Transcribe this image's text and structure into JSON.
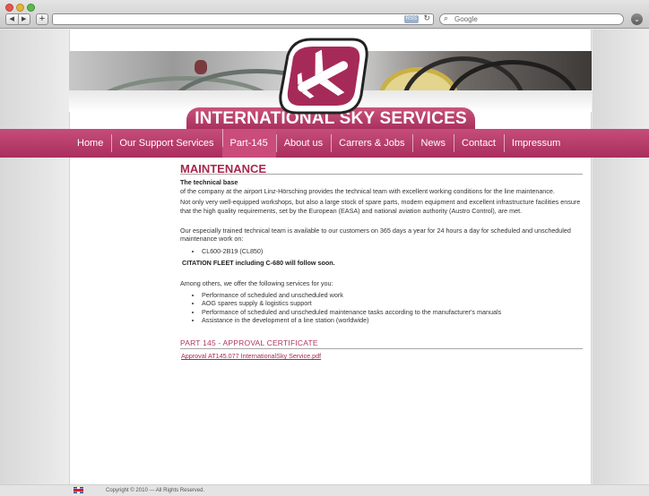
{
  "browser": {
    "back_icon": "back-arrow-icon",
    "forward_icon": "forward-arrow-icon",
    "new_tab_label": "+",
    "rss_label": "RSS",
    "search_placeholder": "Google"
  },
  "site": {
    "title": "INTERNATIONAL SKY SERVICES",
    "brand_color": "#a6294f",
    "logo_icon": "airplane-logo-icon"
  },
  "nav": {
    "items": [
      {
        "label": "Home"
      },
      {
        "label": "Our Support Services"
      },
      {
        "label": "Part-145"
      },
      {
        "label": "About us"
      },
      {
        "label": "Carrers & Jobs"
      },
      {
        "label": "News"
      },
      {
        "label": "Contact"
      },
      {
        "label": "Impressum"
      }
    ],
    "active": "Part-145"
  },
  "content": {
    "heading": "MAINTENANCE",
    "subheading": "The technical base",
    "intro": "of the company at the airport Linz-Hörsching provides the technical team with excellent working conditions for the line maintenance.",
    "para2": "Not only very well-equipped workshops, but also a large stock of spare parts, modern equipment and excellent infrastructure facilities ensure that the high quality requirements, set by the European (EASA) and national aviation authority (Austro Control), are met.",
    "para3": "Our especially trained technical team is available to our customers on 365 days a year for 24 hours a day for scheduled and unscheduled maintenance work on:",
    "aircraft": [
      "CL600-2B19 (CL850)"
    ],
    "citation_note": "CITATION FLEET including C-680 will follow soon.",
    "services_intro": "Among others, we offer the following services for you:",
    "services": [
      "Performance of scheduled and unscheduled work",
      "AOG spares supply & logistics support",
      "Performance of scheduled and unscheduled maintenance tasks according to the manufacturer's manuals",
      "Assistance in the development of a line station (worldwide)"
    ],
    "cert_heading": "PART 145 - APPROVAL CERTIFICATE",
    "cert_link": "Approval AT145.077 InternationalSky Service.pdf"
  },
  "footer": {
    "flag_icon": "uk-flag-icon",
    "copyright": "Copyright © 2010 --- All Rights Reserved."
  }
}
